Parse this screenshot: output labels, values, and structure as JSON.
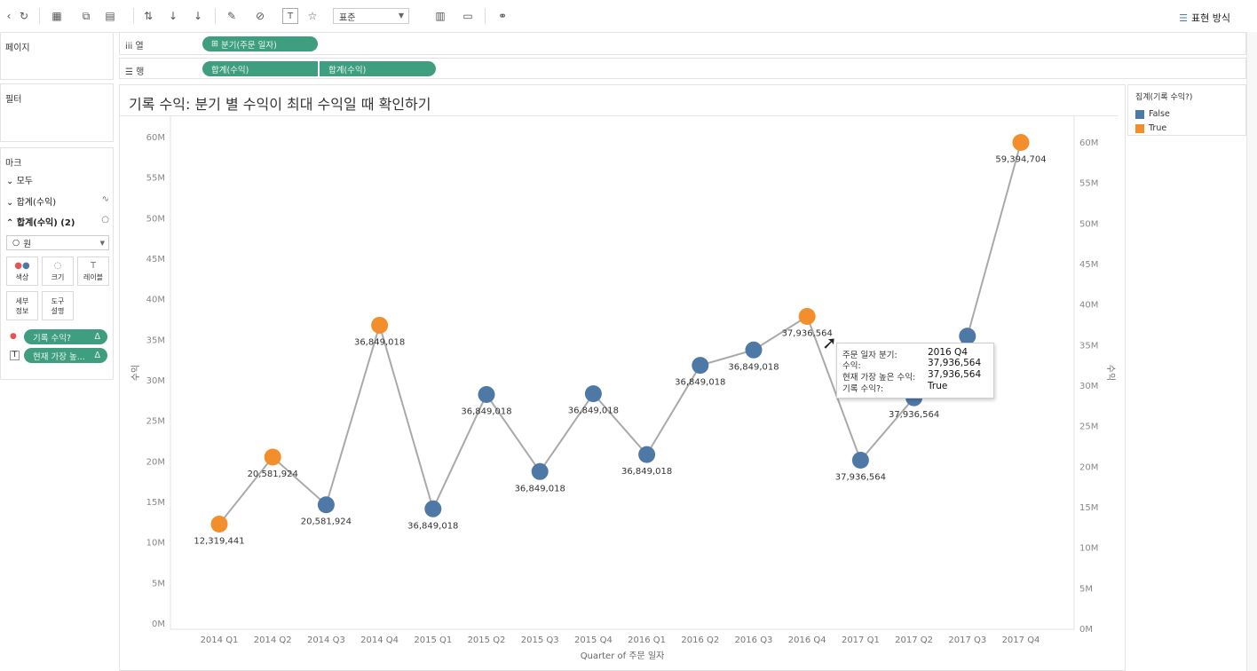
{
  "toolbar": {
    "standard_select": "표준",
    "show_me": "표현 방식"
  },
  "shelves": {
    "pages_title": "페이지",
    "filters_title": "필터",
    "columns_label": "열",
    "rows_label": "행",
    "columns_pill": "분기(주문 일자)",
    "rows_pill_1": "합계(수익)",
    "rows_pill_2": "합계(수익)"
  },
  "marks": {
    "title": "마크",
    "all": "모두",
    "sum1": "합계(수익)",
    "sum2": "합계(수익) (2)",
    "mark_type": "원",
    "btn_color": "색상",
    "btn_size": "크기",
    "btn_label": "레이블",
    "btn_detail_1": "세부",
    "btn_detail_2": "정보",
    "btn_tooltip_1": "도구",
    "btn_tooltip_2": "설명",
    "pill_color": "기록 수익?",
    "pill_label": "현재 가장 높..."
  },
  "legend": {
    "title": "집계(기록 수익?)",
    "items": [
      {
        "label": "False",
        "color": "#4e79a7"
      },
      {
        "label": "True",
        "color": "#f28e2b"
      }
    ]
  },
  "tooltip": {
    "rows": [
      {
        "key": "주문 일자 분기:",
        "value": "2016 Q4"
      },
      {
        "key": "수익:",
        "value": "37,936,564"
      },
      {
        "key": "현재 가장 높은 수익:",
        "value": "37,936,564"
      },
      {
        "key": "기록 수익?:",
        "value": "True"
      }
    ]
  },
  "chart_data": {
    "type": "line",
    "title": "기록 수익: 분기 별 수익이 최대 수익일 때 확인하기",
    "xlabel": "Quarter of 주문 일자",
    "ylabel": "수익",
    "ylabel_right": "수익",
    "ylim": [
      0,
      60000000
    ],
    "yticks": [
      "0M",
      "5M",
      "10M",
      "15M",
      "20M",
      "25M",
      "30M",
      "35M",
      "40M",
      "45M",
      "50M",
      "55M",
      "60M"
    ],
    "categories": [
      "2014 Q1",
      "2014 Q2",
      "2014 Q3",
      "2014 Q4",
      "2015 Q1",
      "2015 Q2",
      "2015 Q3",
      "2015 Q4",
      "2016 Q1",
      "2016 Q2",
      "2016 Q3",
      "2016 Q4",
      "2017 Q1",
      "2017 Q2",
      "2017 Q3",
      "2017 Q4"
    ],
    "series": [
      {
        "values": [
          12319441,
          20581924,
          14700000,
          36849018,
          14200000,
          28300000,
          18800000,
          28400000,
          20900000,
          31900000,
          33800000,
          37936564,
          20200000,
          27900000,
          35500000,
          59394704
        ],
        "record": [
          true,
          true,
          false,
          true,
          false,
          false,
          false,
          false,
          false,
          false,
          false,
          true,
          false,
          false,
          false,
          true
        ]
      }
    ],
    "data_labels": [
      "12,319,441",
      "20,581,924",
      "20,581,924",
      "36,849,018",
      "36,849,018",
      "36,849,018",
      "36,849,018",
      "36,849,018",
      "36,849,018",
      "36,849,018",
      "36,849,018",
      "37,936,564",
      "37,936,564",
      "37,936,564",
      "",
      "59,394,704"
    ],
    "colors": {
      "false": "#4e79a7",
      "true": "#f28e2b",
      "line": "#a9a9a9"
    },
    "grid": false,
    "legend_position": "right"
  }
}
